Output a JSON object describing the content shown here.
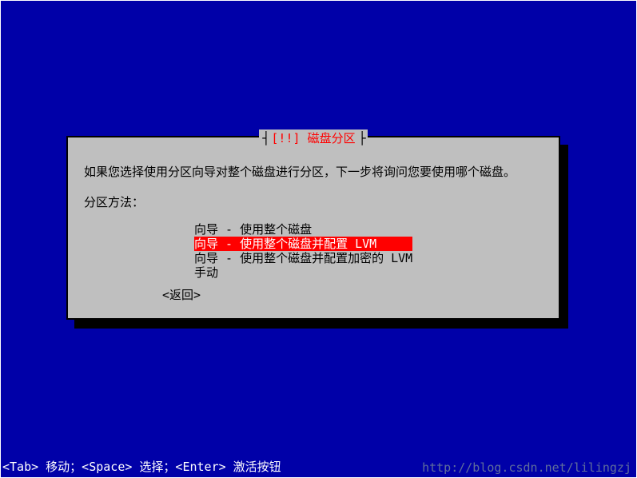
{
  "dialog": {
    "title_prefix": "[!!]",
    "title_text": "磁盘分区",
    "instruction": "如果您选择使用分区向导对整个磁盘进行分区，下一步将询问您要使用哪个磁盘。",
    "method_label": "分区方法：",
    "options": [
      "向导 - 使用整个磁盘",
      "向导 - 使用整个磁盘并配置 LVM",
      "向导 - 使用整个磁盘并配置加密的 LVM",
      "手动"
    ],
    "selected_index": 1,
    "back_label": "<返回>"
  },
  "bottom_hint": "<Tab> 移动；<Space> 选择；<Enter> 激活按钮",
  "watermark": "http://blog.csdn.net/lilingzj"
}
